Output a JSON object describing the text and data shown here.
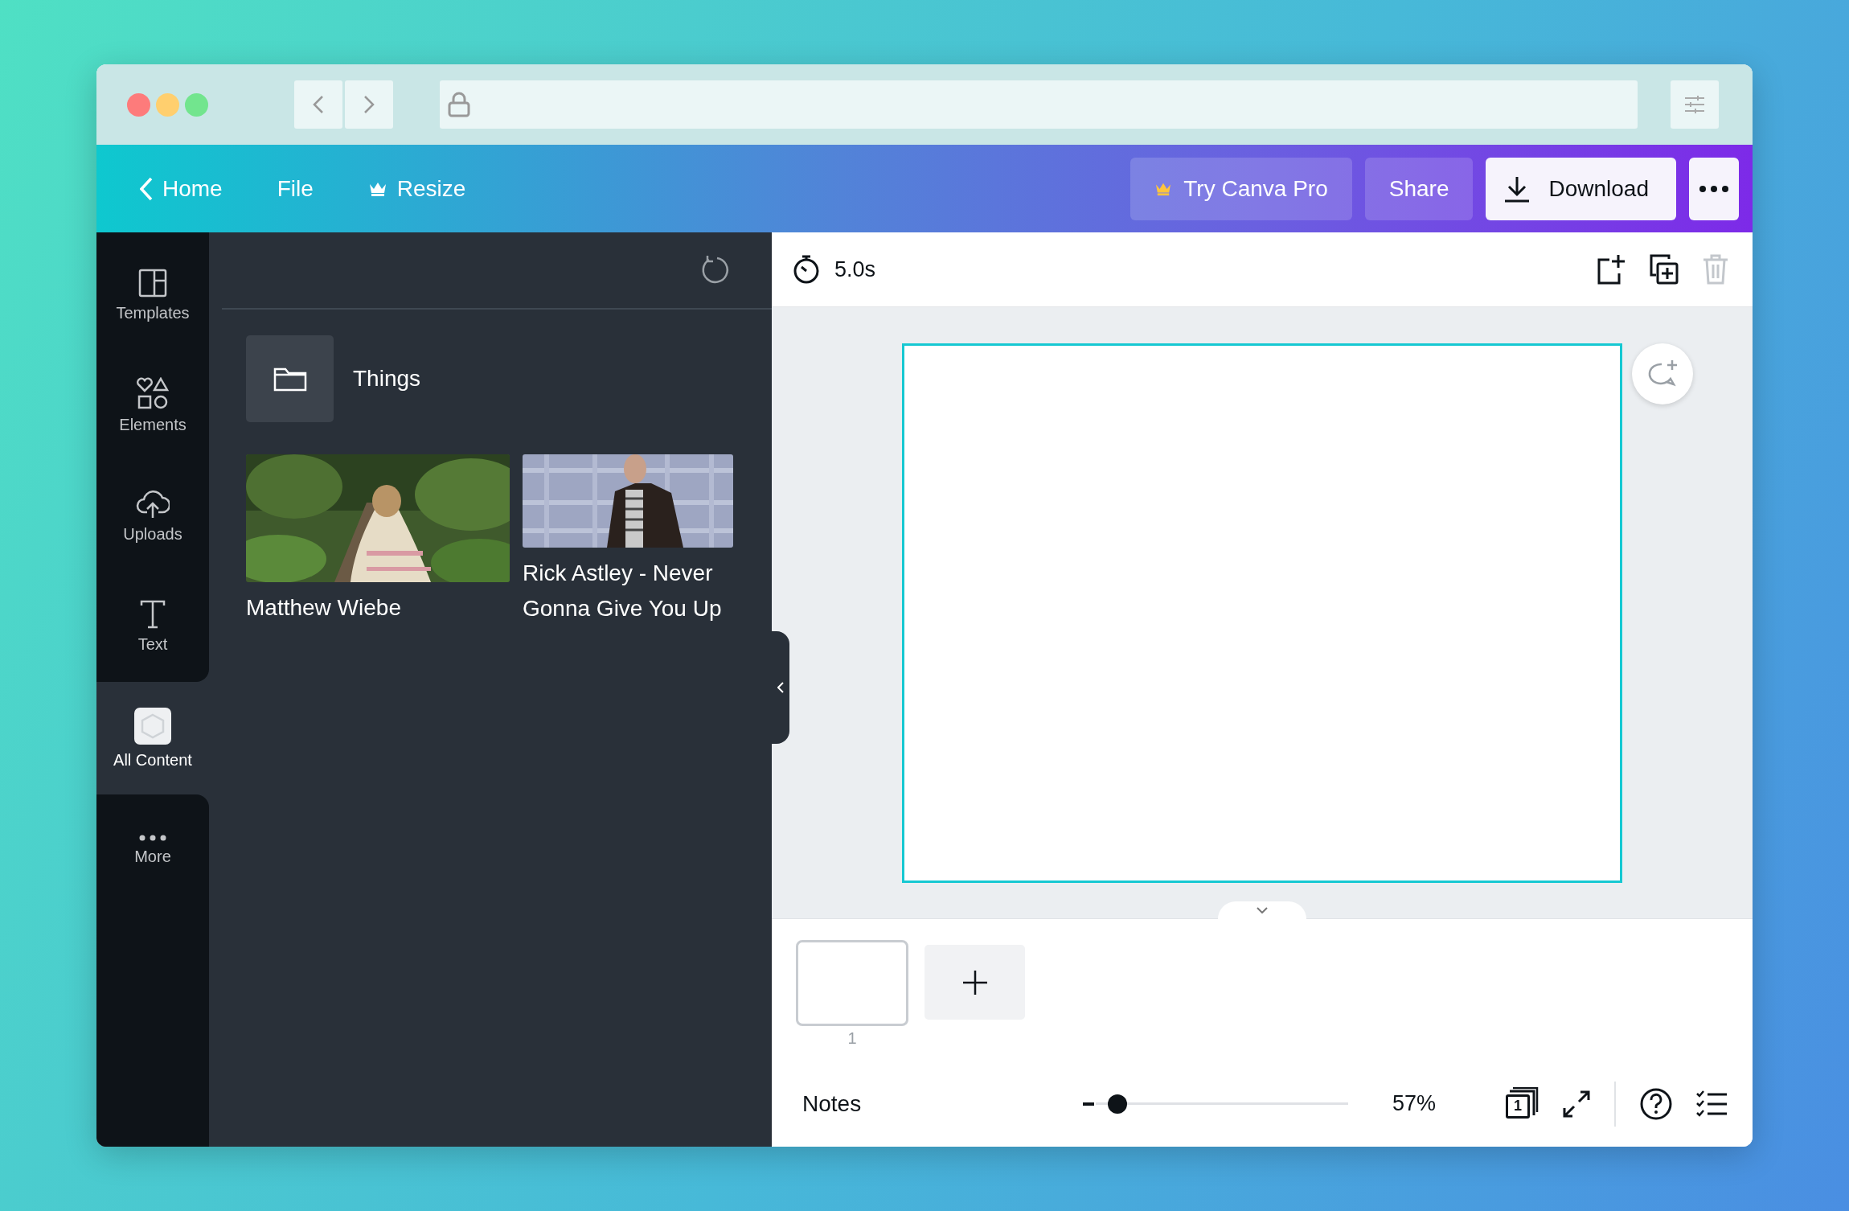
{
  "header": {
    "menu": [
      {
        "label": "Home",
        "kind": "back"
      },
      {
        "label": "File",
        "kind": "plain"
      },
      {
        "label": "Resize",
        "kind": "premium"
      }
    ],
    "actions": [
      {
        "label": "Try Canva Pro",
        "kind": "upgrade"
      },
      {
        "label": "Share",
        "kind": "secondary"
      },
      {
        "label": "Download",
        "kind": "primary"
      }
    ]
  },
  "sidebar": {
    "items": [
      {
        "label": "Templates",
        "kind": "templates",
        "selected": false
      },
      {
        "label": "Elements",
        "kind": "elements",
        "selected": false
      },
      {
        "label": "Uploads",
        "kind": "uploads",
        "selected": false
      },
      {
        "label": "Text",
        "kind": "text",
        "selected": false
      },
      {
        "label": "All Content",
        "kind": "all_content",
        "selected": true
      },
      {
        "label": "More",
        "kind": "more",
        "selected": false
      }
    ]
  },
  "panel": {
    "folders": [
      {
        "name": "Things"
      }
    ],
    "media": [
      {
        "caption": "Matthew Wiebe",
        "kind": "picture"
      },
      {
        "caption": "Rick Astley - Never Gonna Give You Up",
        "kind": "picture"
      }
    ]
  },
  "editor": {
    "duration": "5.0s",
    "tools": [
      {
        "kind": "add_page",
        "disabled": false
      },
      {
        "kind": "duplicate",
        "disabled": false
      },
      {
        "kind": "delete",
        "disabled": true
      }
    ],
    "pages": [
      {
        "number": "1"
      }
    ],
    "footer": {
      "notes": "Notes",
      "zoom": {
        "level": 0.05,
        "reading": "57%"
      },
      "page_count": "1"
    }
  }
}
